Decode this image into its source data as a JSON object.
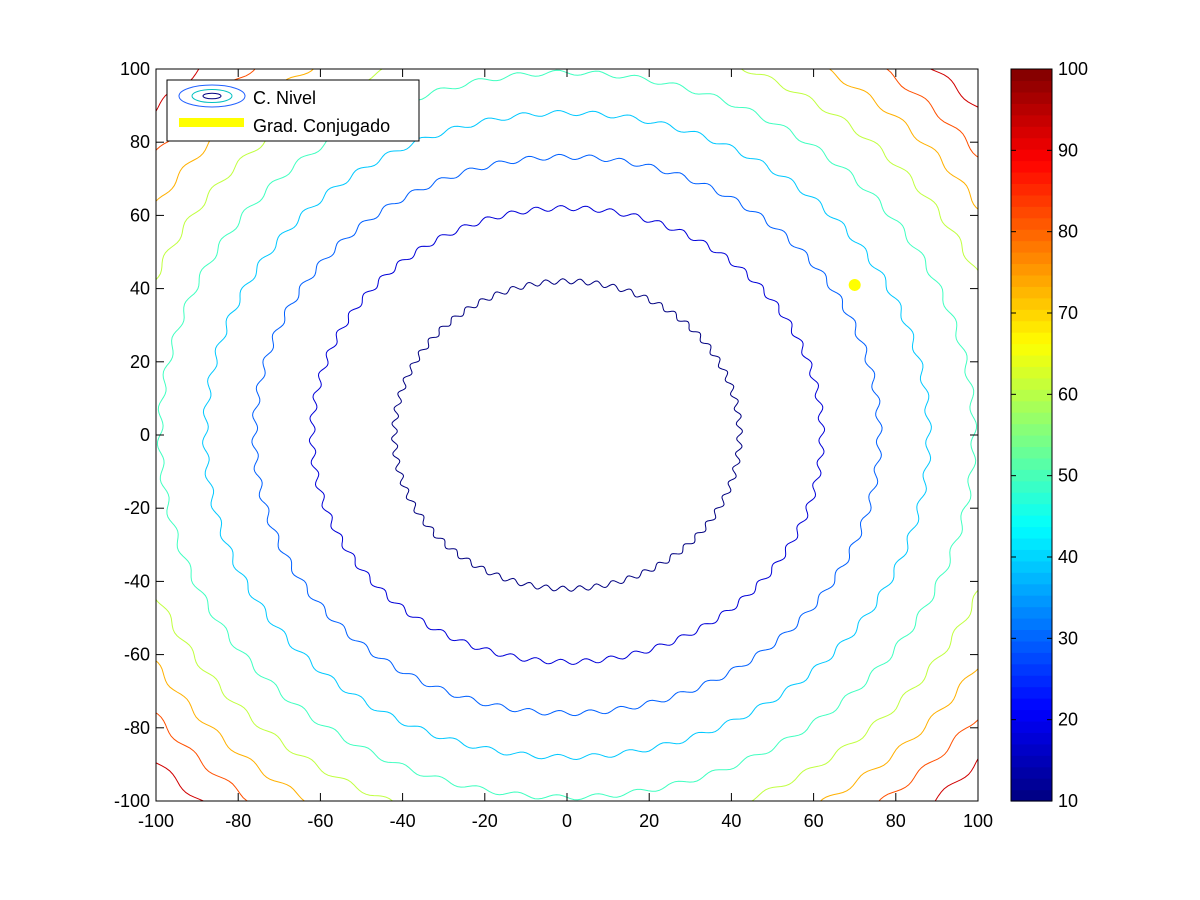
{
  "chart_data": {
    "type": "contour",
    "title": "",
    "xlabel": "",
    "ylabel": "",
    "xlim": [
      -100,
      100
    ],
    "ylim": [
      -100,
      100
    ],
    "grid": false,
    "x_ticks": [
      -100,
      -80,
      -60,
      -40,
      -20,
      0,
      20,
      40,
      60,
      80,
      100
    ],
    "y_ticks": [
      -100,
      -80,
      -60,
      -40,
      -20,
      0,
      20,
      40,
      60,
      80,
      100
    ],
    "colorbar": {
      "colormap": "jet",
      "range": [
        10,
        100
      ],
      "ticks": [
        10,
        20,
        30,
        40,
        50,
        60,
        70,
        80,
        90,
        100
      ]
    },
    "contour_levels": [
      {
        "level": 10,
        "radius": 42,
        "color": "#000080"
      },
      {
        "level": 20,
        "radius": 62,
        "color": "#0000d8"
      },
      {
        "level": 30,
        "radius": 76,
        "color": "#0060ff"
      },
      {
        "level": 40,
        "radius": 88,
        "color": "#00c8ff"
      },
      {
        "level": 50,
        "radius": 99,
        "color": "#40ffc0"
      },
      {
        "level": 60,
        "radius": 109,
        "color": "#c0ff40"
      },
      {
        "level": 70,
        "radius": 118,
        "color": "#ffb000"
      },
      {
        "level": 80,
        "radius": 126,
        "color": "#ff5000"
      },
      {
        "level": 90,
        "radius": 134,
        "color": "#d00000"
      }
    ],
    "series": [
      {
        "name": "C. Nivel",
        "type": "contour"
      },
      {
        "name": "Grad. Conjugado",
        "type": "line",
        "color": "#ffff00",
        "points": [
          [
            70,
            41
          ]
        ]
      }
    ],
    "legend": {
      "placement": "top-left",
      "entries": [
        "C. Nivel",
        "Grad. Conjugado"
      ]
    }
  }
}
